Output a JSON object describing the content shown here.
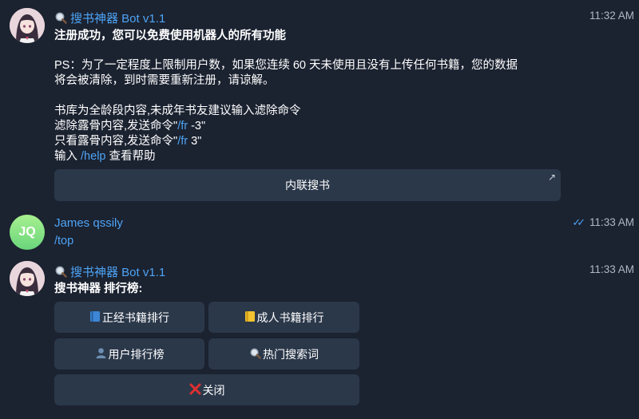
{
  "messages": [
    {
      "sender": "搜书神器 Bot v1.1",
      "time": "11:32 AM",
      "line_title": "注册成功，您可以免费使用机器人的所有功能",
      "line_ps1": "PS：为了一定程度上限制用户数，如果您连续 60 天未使用且没有上传任何书籍，您的数据",
      "line_ps2": "将会被清除，到时需要重新注册，请谅解。",
      "line_lib": "书库为全龄段内容,未成年书友建议输入滤除命令",
      "line_filter_pre": "滤除露骨内容,发送命令\"",
      "line_filter_cmd": "/fr",
      "line_filter_post": " -3\"",
      "line_only_pre": "只看露骨内容,发送命令\"",
      "line_only_cmd": "/fr",
      "line_only_post": " 3\"",
      "line_help_pre": "输入 ",
      "line_help_cmd": "/help",
      "line_help_post": " 查看帮助",
      "button_inline": "内联搜书"
    },
    {
      "sender": "James qssily",
      "initials": "JQ",
      "time": "11:33 AM",
      "text": "/top"
    },
    {
      "sender": "搜书神器 Bot v1.1",
      "time": "11:33 AM",
      "title": "搜书神器 排行榜:",
      "buttons": {
        "formal": "正经书籍排行",
        "adult": "成人书籍排行",
        "users": "用户排行榜",
        "hot": "热门搜索词",
        "close": "关闭"
      }
    }
  ],
  "colors": {
    "background": "#1b2230",
    "link": "#4ea4f5",
    "button": "#2b384a"
  },
  "icons": [
    "magnifier-icon",
    "external-link-icon",
    "double-check-icon",
    "book-blue-icon",
    "book-yellow-icon",
    "user-icon",
    "close-x-icon"
  ]
}
